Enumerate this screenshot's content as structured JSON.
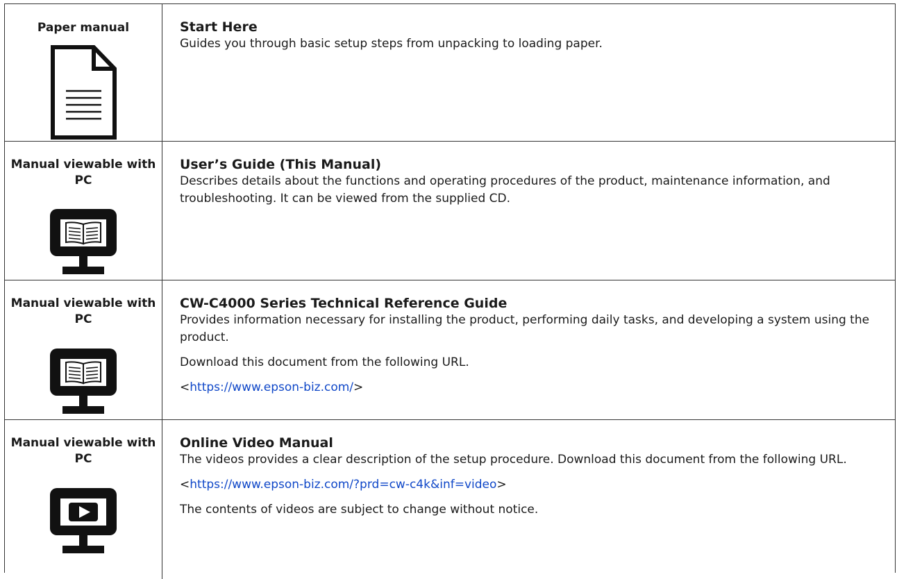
{
  "rows": [
    {
      "left_title": "Paper manual",
      "icon": "paper-document-icon",
      "title": "Start Here",
      "paragraphs": [
        "Guides you through basic setup steps from unpacking to loading paper."
      ]
    },
    {
      "left_title": "Manual viewable with PC",
      "icon": "monitor-book-icon",
      "title": "User’s Guide (This Manual)",
      "paragraphs": [
        "Describes details about the functions and operating procedures of the product, maintenance information, and troubleshooting. It can be viewed from the supplied CD."
      ]
    },
    {
      "left_title": "Manual viewable with PC",
      "icon": "monitor-book-icon",
      "title": "CW-C4000 Series Technical Reference Guide",
      "paragraphs": [
        "Provides information necessary for installing the product, performing daily tasks, and developing a system using the product.",
        "Download this document from the following URL."
      ],
      "link_prefix": "<",
      "link": "https://www.epson-biz.com/",
      "link_suffix": ">"
    },
    {
      "left_title": "Manual viewable with PC",
      "icon": "monitor-play-icon",
      "title": "Online Video Manual",
      "paragraphs": [
        "The videos provides a clear description of the setup procedure. Download this document from the following URL."
      ],
      "link_prefix": "<",
      "link": "https://www.epson-biz.com/?prd=cw-c4k&inf=video",
      "link_suffix": ">",
      "after_link": "The contents of videos are subject to change without notice."
    }
  ]
}
